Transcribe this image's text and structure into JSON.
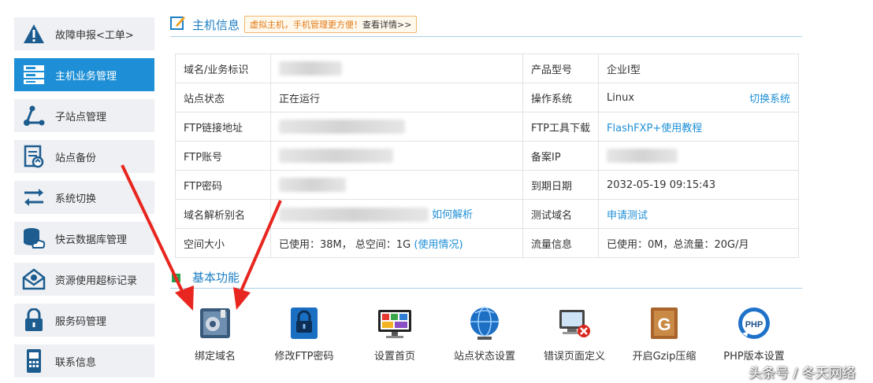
{
  "sidebar": {
    "items": [
      {
        "label": "故障申报<工单>",
        "icon": "warning-icon"
      },
      {
        "label": "主机业务管理",
        "icon": "server-icon",
        "active": true
      },
      {
        "label": "子站点管理",
        "icon": "branch-icon"
      },
      {
        "label": "站点备份",
        "icon": "backup-doc-icon"
      },
      {
        "label": "系统切换",
        "icon": "switch-arrows-icon"
      },
      {
        "label": "快云数据库管理",
        "icon": "database-cloud-icon"
      },
      {
        "label": "资源使用超标记录",
        "icon": "mail-alert-icon"
      },
      {
        "label": "服务码管理",
        "icon": "lock-icon"
      },
      {
        "label": "联系信息",
        "icon": "phone-icon"
      }
    ]
  },
  "host_info": {
    "title": "主机信息",
    "promo": "虚拟主机，手机管理更方便！",
    "promo_link": "查看详情>>"
  },
  "table": {
    "rows": [
      {
        "l1": "域名/业务标识",
        "v1": "",
        "l2": "产品型号",
        "v2": "企业I型"
      },
      {
        "l1": "站点状态",
        "v1": "正在运行",
        "l2": "操作系统",
        "v2": "Linux",
        "v2_link": "切换系统"
      },
      {
        "l1": "FTP链接地址",
        "v1": "",
        "l2": "FTP工具下载",
        "v2_link": "FlashFXP+使用教程"
      },
      {
        "l1": "FTP账号",
        "v1": "",
        "l2": "备案IP",
        "v2": ""
      },
      {
        "l1": "FTP密码",
        "v1": "",
        "l2": "到期日期",
        "v2": "2032-05-19 09:15:43"
      },
      {
        "l1": "域名解析别名",
        "v1_link": "如何解析",
        "l2": "测试域名",
        "v2_link": "申请测试"
      },
      {
        "l1": "空间大小",
        "v1": "已使用：38M， 总空间：1G",
        "v1_link": "(使用情况)",
        "l2": "流量信息",
        "v2": "已使用：0M，总流量：20G/月"
      }
    ]
  },
  "basic": {
    "title": "基本功能",
    "functions": [
      {
        "label": "绑定域名",
        "icon": "bind-domain-icon"
      },
      {
        "label": "修改FTP密码",
        "icon": "ftp-lock-icon"
      },
      {
        "label": "设置首页",
        "icon": "homepage-monitor-icon"
      },
      {
        "label": "站点状态设置",
        "icon": "globe-status-icon"
      },
      {
        "label": "错误页面定义",
        "icon": "error-page-icon"
      },
      {
        "label": "开启Gzip压缩",
        "icon": "gzip-icon"
      },
      {
        "label": "PHP版本设置",
        "icon": "php-icon"
      }
    ]
  },
  "watermark": "头条号 / 冬天网络",
  "colors": {
    "accent": "#1e8fd6",
    "arrow": "#e8261f",
    "promo": "#e07a16"
  }
}
